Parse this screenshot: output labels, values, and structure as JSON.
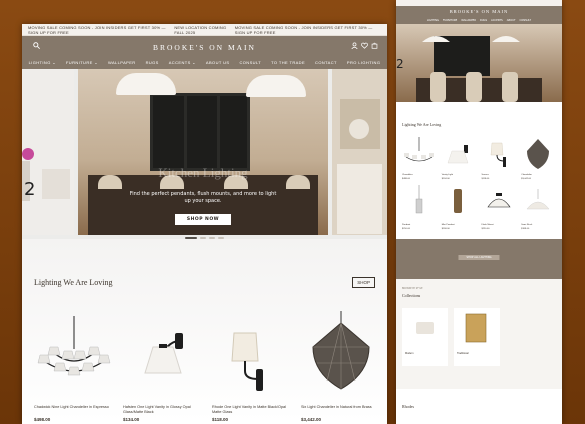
{
  "desktop": {
    "announcements": [
      "MOVING SALE COMING SOON - JOIN INSIDERS GET FIRST 30% — SIGN UP FOR FREE",
      "NEW LOCATION COMING FALL 2025",
      "MOVING SALE COMING SOON - JOIN INSIDERS GET FIRST 30% — SIGN UP FOR FREE"
    ],
    "logo": "BROOKE'S ON MAIN",
    "nav": [
      "LIGHTING ⌄",
      "FURNITURE ⌄",
      "WALLPAPER",
      "RUGS",
      "ACCENTS ⌄",
      "ABOUT US",
      "CONSULT",
      "TO THE TRADE",
      "CONTACT",
      "PRO LIGHTING"
    ],
    "hero": {
      "title": "Kitchen Lighting",
      "subtitle": "Find the perfect pendants, flush mounts, and more to light up your space.",
      "button": "SHOP NOW"
    },
    "section_title": "Lighting We Are Loving",
    "shop_label": "SHOP",
    "products": [
      {
        "title": "Chadwick Nine Light Chandelier in Espresso",
        "price": "$498.00"
      },
      {
        "title": "Hafsten One Light Vanity in Glossy Opal Glass/Matte Black",
        "price": "$134.00"
      },
      {
        "title": "Rhode One Light Vanity in Matte Black/Opal Matte Glass",
        "price": "$118.00"
      },
      {
        "title": "Six Light Chandelier in Natural from Brass",
        "price": "$3,442.00"
      }
    ],
    "colors": {
      "header": "#85786a",
      "accent": "#3b332b"
    }
  },
  "mobile": {
    "logo": "BROOKE'S ON MAIN",
    "nav": [
      "LIGHTING",
      "FURNITURE",
      "WALLPAPER",
      "RUGS",
      "ACCENTS",
      "ABOUT",
      "CONSULT"
    ],
    "section_title": "Lighting We Are Loving",
    "products": [
      {
        "title": "Chandelier",
        "price": "$498.00"
      },
      {
        "title": "Vanity Light",
        "price": "$134.00"
      },
      {
        "title": "Sconce",
        "price": "$118.00"
      },
      {
        "title": "Chandelier",
        "price": "$3,442.00"
      },
      {
        "title": "Pendant",
        "price": "$210.00"
      },
      {
        "title": "Mini Pendant",
        "price": "$158.00"
      },
      {
        "title": "Flush Mount",
        "price": "$220.00"
      },
      {
        "title": "Semi Flush",
        "price": "$189.00"
      }
    ],
    "band_button": "SHOP ALL LIGHTING",
    "collections_kicker": "BROWSE BY STYLE",
    "collections_title": "Collections",
    "collection_cards": [
      "Modern",
      "Traditional"
    ],
    "bottom_title": "Rhodes"
  }
}
